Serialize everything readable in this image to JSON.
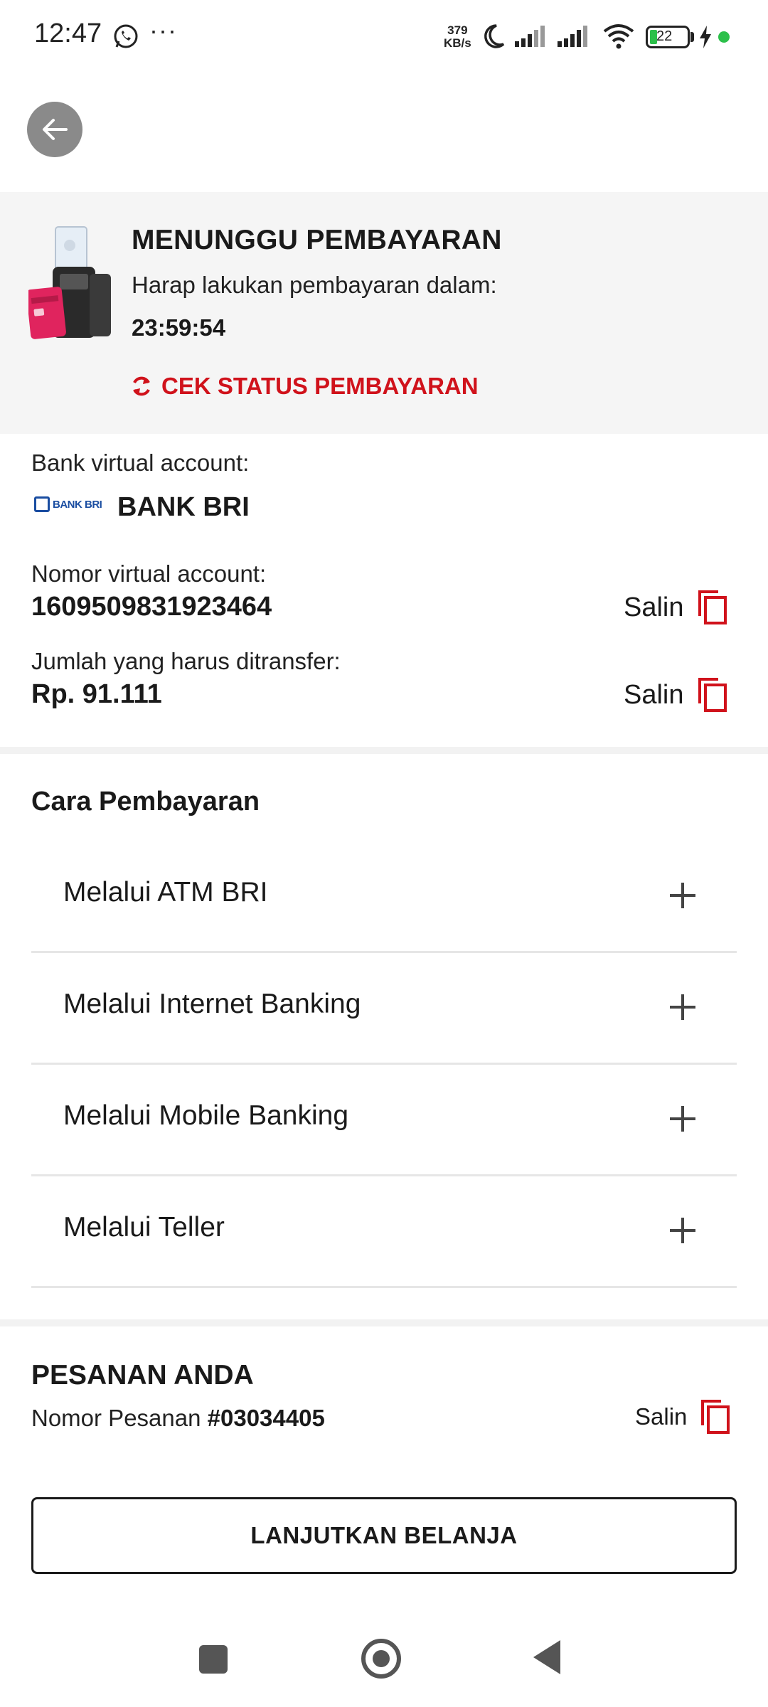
{
  "status_bar": {
    "time": "12:47",
    "dots": "···",
    "speed_value": "379",
    "speed_unit": "KB/s",
    "battery": "22",
    "accent_green": "#2cc04a"
  },
  "header": {
    "back_icon": "arrow-left-icon"
  },
  "waiting": {
    "title": "MENUNGGU PEMBAYARAN",
    "subtitle": "Harap lakukan pembayaran dalam:",
    "timer": "23:59:54",
    "check_label": "CEK STATUS PEMBAYARAN",
    "accent": "#d0121b"
  },
  "virtual_account": {
    "label": "Bank virtual account:",
    "bank_logo_text": "BANK BRI",
    "bank_name": "BANK BRI",
    "number_label": "Nomor virtual account:",
    "number": "1609509831923464",
    "amount_label": "Jumlah yang harus ditransfer:",
    "amount": "Rp. 91.111",
    "copy_label": "Salin"
  },
  "payment_methods": {
    "title": "Cara Pembayaran",
    "items": [
      {
        "label": "Melalui ATM BRI"
      },
      {
        "label": "Melalui Internet Banking"
      },
      {
        "label": "Melalui Mobile Banking"
      },
      {
        "label": "Melalui Teller"
      }
    ]
  },
  "order": {
    "title": "PESANAN ANDA",
    "number_label": "Nomor Pesanan",
    "number": "#03034405",
    "copy_label": "Salin"
  },
  "cta": {
    "label": "LANJUTKAN BELANJA"
  }
}
